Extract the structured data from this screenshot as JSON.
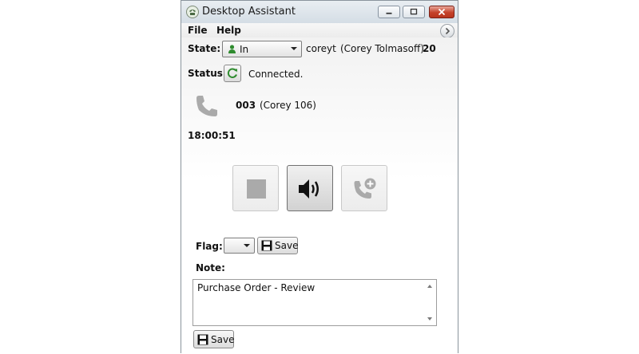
{
  "window": {
    "title": "Desktop Assistant"
  },
  "menu": {
    "file": "File",
    "help": "Help"
  },
  "state": {
    "label": "State:",
    "value": "In",
    "username": "coreyt",
    "fullname": "(Corey Tolmasoff)",
    "number": "20"
  },
  "status": {
    "label": "Status:",
    "value": "Connected."
  },
  "call": {
    "line": "003",
    "description": "(Corey 106)",
    "timer": "18:00:51"
  },
  "controls": {
    "stop": "stop",
    "speaker": "speaker",
    "add_call": "add-call"
  },
  "flag": {
    "label": "Flag:",
    "value": "",
    "save_label": "Save"
  },
  "note": {
    "label": "Note:",
    "text": "Purchase Order - Review"
  },
  "footer": {
    "save_label": "Save"
  },
  "colors": {
    "state_icon": "#2e8b2e",
    "close_button": "#c5422a",
    "disabled_icon": "#aaaaaa"
  }
}
